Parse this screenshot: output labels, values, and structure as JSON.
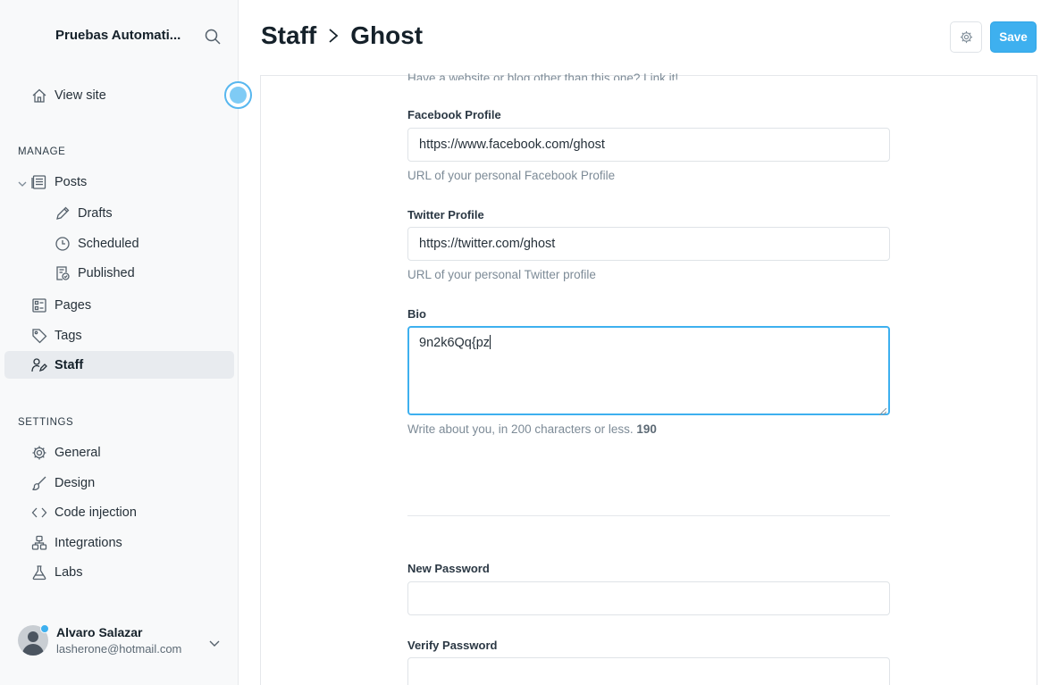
{
  "sidebar": {
    "site_title": "Pruebas Automati...",
    "view_site": "View site",
    "manage_label": "MANAGE",
    "posts": "Posts",
    "drafts": "Drafts",
    "scheduled": "Scheduled",
    "published": "Published",
    "pages": "Pages",
    "tags": "Tags",
    "staff": "Staff",
    "settings_label": "SETTINGS",
    "general": "General",
    "design": "Design",
    "code_injection": "Code injection",
    "integrations": "Integrations",
    "labs": "Labs"
  },
  "user": {
    "name": "Alvaro Salazar",
    "email": "lasherone@hotmail.com"
  },
  "header": {
    "crumb_parent": "Staff",
    "crumb_current": "Ghost",
    "save_label": "Save"
  },
  "form": {
    "website_hint": "Have a website or blog other than this one? Link it!",
    "facebook_label": "Facebook Profile",
    "facebook_value": "https://www.facebook.com/ghost",
    "facebook_hint": "URL of your personal Facebook Profile",
    "twitter_label": "Twitter Profile",
    "twitter_value": "https://twitter.com/ghost",
    "twitter_hint": "URL of your personal Twitter profile",
    "bio_label": "Bio",
    "bio_value": "9n2k6Qq{pz",
    "bio_hint": "Write about you, in 200 characters or less.",
    "bio_count": "190",
    "new_password_label": "New Password",
    "verify_password_label": "Verify Password"
  },
  "colors": {
    "accent": "#3eb0ef",
    "sidebar_bg": "#f8f9fa",
    "active_bg": "#e8ebef"
  }
}
